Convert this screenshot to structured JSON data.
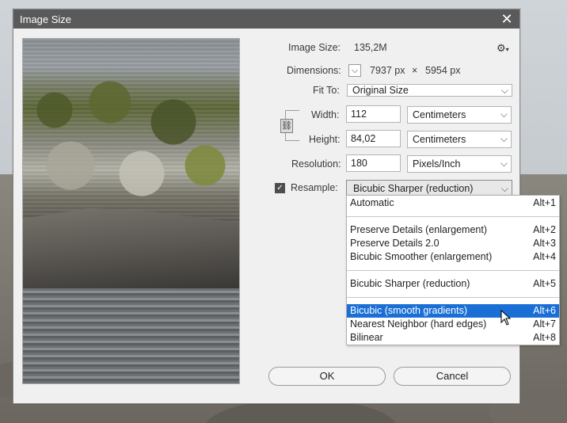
{
  "dialog": {
    "title": "Image Size",
    "close_glyph": "✕"
  },
  "image_size": {
    "label": "Image Size:",
    "value": "135,2M"
  },
  "dimensions": {
    "label": "Dimensions:",
    "width_px": "7937 px",
    "times": "×",
    "height_px": "5954 px"
  },
  "fit_to": {
    "label": "Fit To:",
    "value": "Original Size"
  },
  "width": {
    "label": "Width:",
    "value": "112",
    "unit": "Centimeters"
  },
  "height": {
    "label": "Height:",
    "value": "84,02",
    "unit": "Centimeters"
  },
  "resolution": {
    "label": "Resolution:",
    "value": "180",
    "unit": "Pixels/Inch"
  },
  "resample": {
    "label": "Resample:",
    "checked_glyph": "✓",
    "value": "Bicubic Sharper (reduction)"
  },
  "menu": {
    "items": [
      {
        "label": "Automatic",
        "shortcut": "Alt+1"
      },
      {
        "label": "Preserve Details (enlargement)",
        "shortcut": "Alt+2"
      },
      {
        "label": "Preserve Details 2.0",
        "shortcut": "Alt+3"
      },
      {
        "label": "Bicubic Smoother (enlargement)",
        "shortcut": "Alt+4"
      },
      {
        "label": "Bicubic Sharper (reduction)",
        "shortcut": "Alt+5"
      },
      {
        "label": "Bicubic (smooth gradients)",
        "shortcut": "Alt+6"
      },
      {
        "label": "Nearest Neighbor (hard edges)",
        "shortcut": "Alt+7"
      },
      {
        "label": "Bilinear",
        "shortcut": "Alt+8"
      }
    ],
    "highlighted_index": 5
  },
  "buttons": {
    "ok": "OK",
    "cancel": "Cancel"
  },
  "icons": {
    "gear": "⚙",
    "chevron": "⌵",
    "link": "⛓"
  },
  "colors": {
    "titlebar": "#5a5a5a",
    "highlight": "#1a6fd6",
    "dialog_bg": "#f0f0f0"
  }
}
